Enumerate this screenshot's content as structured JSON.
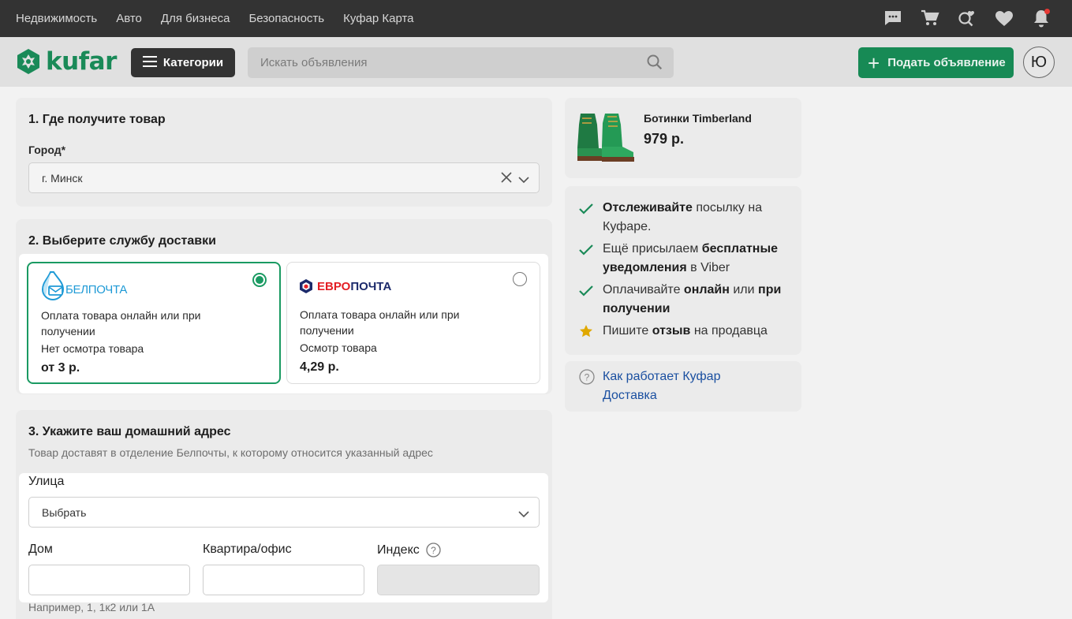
{
  "topbar": {
    "nav": [
      "Недвижимость",
      "Авто",
      "Для бизнеса",
      "Безопасность",
      "Куфар Карта"
    ],
    "icons": [
      "chat-icon",
      "cart-icon",
      "saved-search-icon",
      "heart-icon",
      "bell-icon"
    ]
  },
  "header": {
    "logo": "kufar",
    "categories_label": "Категории",
    "search_placeholder": "Искать объявления",
    "post_label": "Подать объявление",
    "avatar_letter": "Ю"
  },
  "section1": {
    "title": "1. Где получите товар",
    "city_label": "Город*",
    "city_value": "г. Минск"
  },
  "section2": {
    "title": "2. Выберите службу доставки",
    "services": [
      {
        "logo": "БЕЛПОЧТА",
        "payment_line1": "Оплата товара онлайн или при",
        "payment_line2": "получении",
        "inspection": "Нет осмотра товара",
        "price": "от 3 р.",
        "selected": true
      },
      {
        "logo_part1": "ЕВРО",
        "logo_part2": "ПОЧТА",
        "payment_line1": "Оплата товара онлайн или при",
        "payment_line2": "получении",
        "inspection": "Осмотр товара",
        "price": "4,29 р.",
        "selected": false
      }
    ]
  },
  "section3": {
    "title": "3. Укажите ваш домашний адрес",
    "subtitle": "Товар доставят в отделение Белпочты, к которому относится указанный адрес",
    "street_label": "Улица",
    "street_value": "Выбрать",
    "house_label": "Дом",
    "apt_label": "Квартира/офис",
    "index_label": "Индекс",
    "house_hint": "Например, 1, 1к2 или 1А"
  },
  "product": {
    "name": "Ботинки Timberland",
    "price": "979 р."
  },
  "features": {
    "f1_bold": "Отслеживайте",
    "f1_rest1": " посылку на",
    "f1_rest2": "Куфаре.",
    "f2_pre": "Ещё присылаем ",
    "f2_bold1": "бесплатные",
    "f2_bold2": "уведомления",
    "f2_rest": " в Viber",
    "f3_pre": "Оплачивайте ",
    "f3_bold1": "онлайн",
    "f3_mid": " или ",
    "f3_bold2": "при",
    "f3_bold3": "получении",
    "f4_pre": "Пишите ",
    "f4_bold": "отзыв",
    "f4_rest": " на продавца"
  },
  "help": {
    "line1": "Как работает Куфар",
    "line2": "Доставка"
  },
  "colors": {
    "brand_green": "#178a55",
    "selected_border": "#1a9a62",
    "link_blue": "#1a4fa0",
    "topbar": "#333333",
    "star": "#e0a800",
    "belpochta_blue": "#1e9ad6",
    "europochta_red": "#e31e24",
    "europochta_navy": "#1c2a6b"
  }
}
